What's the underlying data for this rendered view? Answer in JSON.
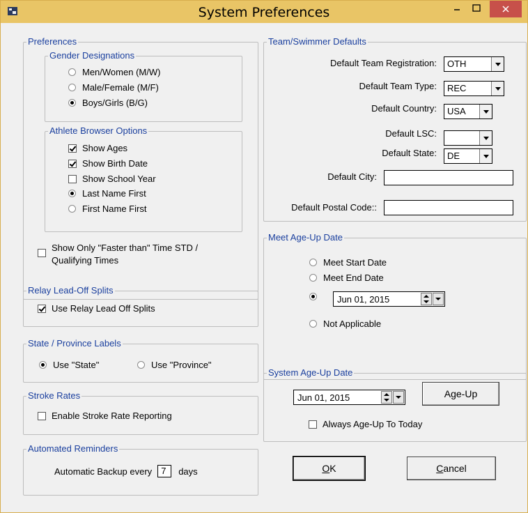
{
  "window": {
    "title": "System Preferences",
    "accent": "#e9c566",
    "close_color": "#c7504a"
  },
  "preferences": {
    "title": "Preferences",
    "gender": {
      "title": "Gender Designations",
      "options": [
        "Men/Women (M/W)",
        "Male/Female (M/F)",
        "Boys/Girls (B/G)"
      ],
      "selected": "Boys/Girls (B/G)"
    },
    "browser": {
      "title": "Athlete Browser Options",
      "show_ages": "Show Ages",
      "show_birth_date": "Show Birth Date",
      "show_school_year": "Show School Year",
      "last_name_first": "Last Name First",
      "first_name_first": "First Name First"
    },
    "faster_than_line1": "Show Only   \"Faster than\" Time STD /",
    "faster_than_line2": "Qualifying Times"
  },
  "relay": {
    "title": "Relay Lead-Off Splits",
    "use_splits": "Use Relay Lead Off Splits"
  },
  "state_labels": {
    "title": "State / Province Labels",
    "use_state": "Use \"State\"",
    "use_province": "Use \"Province\""
  },
  "stroke": {
    "title": "Stroke Rates",
    "enable": "Enable Stroke Rate Reporting"
  },
  "reminders": {
    "title": "Automated Reminders",
    "backup_prefix": "Automatic Backup every",
    "backup_days": "7",
    "backup_suffix": "days"
  },
  "team": {
    "title": "Team/Swimmer Defaults",
    "registration_label": "Default Team Registration:",
    "registration": "OTH",
    "type_label": "Default Team Type:",
    "type": "REC",
    "country_label": "Default Country:",
    "country": "USA",
    "lsc_label": "Default LSC:",
    "lsc": "",
    "state_label": "Default State:",
    "state": "DE",
    "city_label": "Default City:",
    "city": "",
    "postal_label": "Default Postal Code::",
    "postal": ""
  },
  "meet_ageup": {
    "title": "Meet Age-Up Date",
    "start": "Meet Start Date",
    "end": "Meet End Date",
    "custom_date": "Jun 01, 2015",
    "na": "Not Applicable"
  },
  "system_ageup": {
    "title": "System Age-Up Date",
    "date": "Jun 01, 2015",
    "ageup_button": "Age-Up",
    "always_today": "Always Age-Up To Today"
  },
  "buttons": {
    "ok_u": "O",
    "ok_rest": "K",
    "cancel_u": "C",
    "cancel_rest": "ancel"
  }
}
